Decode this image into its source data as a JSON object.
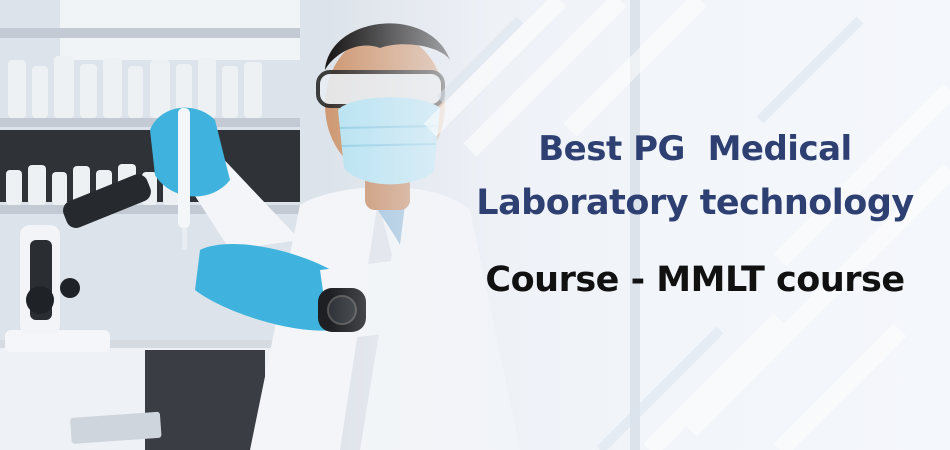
{
  "banner": {
    "headline_line1": "Best PG  Medical",
    "headline_line2": "Laboratory technology",
    "subline": "Course - MMLT course",
    "colors": {
      "headline": "#2e3f72",
      "subline": "#111111",
      "background": "#f1f4f9",
      "glove": "#3fb3dd",
      "coat": "#f3f5f8"
    },
    "photo_subject": "lab-technician-with-pipette-and-microscope"
  }
}
